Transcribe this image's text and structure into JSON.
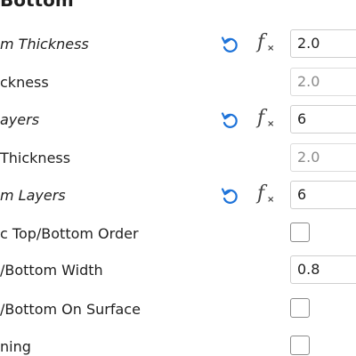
{
  "section": {
    "title": "Bottom"
  },
  "settings": [
    {
      "label": "m Thickness",
      "italic": true,
      "value": "2.0",
      "disabled": false,
      "reset": true,
      "fx": true
    },
    {
      "label": "ckness",
      "italic": false,
      "value": "2.0",
      "disabled": true,
      "reset": false,
      "fx": false
    },
    {
      "label": "ayers",
      "italic": true,
      "value": "6",
      "disabled": false,
      "reset": true,
      "fx": true
    },
    {
      "label": " Thickness",
      "italic": false,
      "value": "2.0",
      "disabled": true,
      "reset": false,
      "fx": false
    },
    {
      "label": "m Layers",
      "italic": true,
      "value": "6",
      "disabled": false,
      "reset": true,
      "fx": true
    },
    {
      "label": "c Top/Bottom Order",
      "italic": false,
      "checkbox": true,
      "checked": false
    },
    {
      "label": "/Bottom Width",
      "italic": false,
      "value": "0.8",
      "disabled": false,
      "reset": false,
      "fx": false
    },
    {
      "label": "/Bottom On Surface",
      "italic": false,
      "checkbox": true,
      "checked": false
    },
    {
      "label": "ning",
      "italic": false,
      "checkbox": true,
      "checked": false
    }
  ],
  "colors": {
    "reset_icon": "#1e73d9",
    "fx_icon": "#444444",
    "text": "#1f1f1f",
    "disabled_text": "#8a8a8a"
  }
}
